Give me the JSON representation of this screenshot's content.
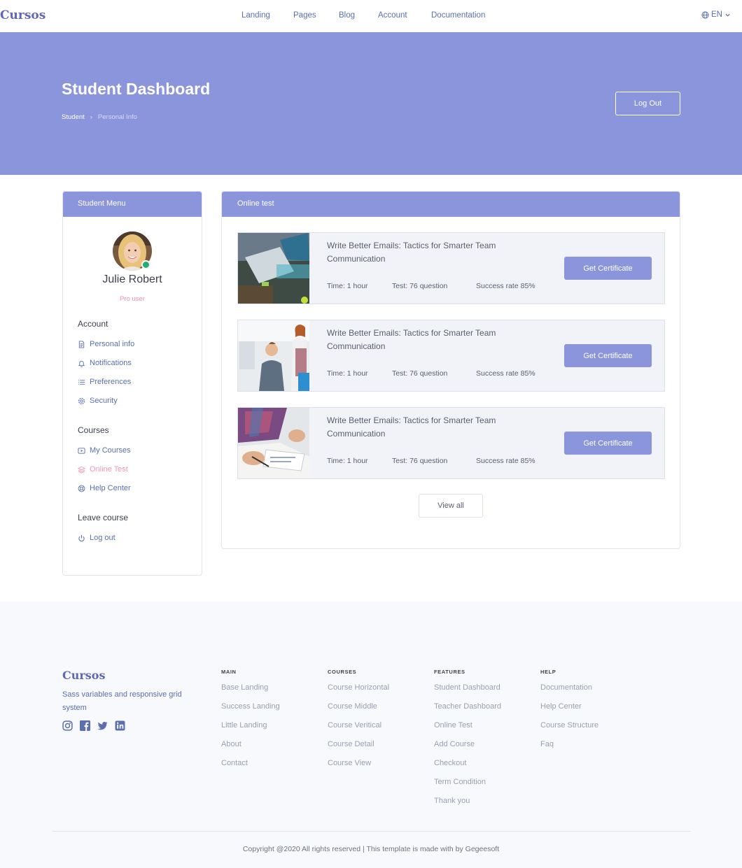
{
  "nav": {
    "brand": "Cursos",
    "links": [
      "Landing",
      "Pages",
      "Blog",
      "Account",
      "Documentation"
    ],
    "language": "EN"
  },
  "hero": {
    "title": "Student Dashboard",
    "breadcrumb": [
      "Student",
      "Personal Info"
    ],
    "logout_label": "Log Out"
  },
  "sidebar": {
    "header": "Student Menu",
    "user_name": "Julie Robert",
    "user_role": "Pro user",
    "sections": [
      {
        "title": "Account",
        "items": [
          {
            "label": "Personal info",
            "icon": "document-icon"
          },
          {
            "label": "Notifications",
            "icon": "bell-icon"
          },
          {
            "label": "Preferences",
            "icon": "list-icon"
          },
          {
            "label": "Security",
            "icon": "gear-icon"
          }
        ]
      },
      {
        "title": "Courses",
        "items": [
          {
            "label": "My Courses",
            "icon": "video-icon"
          },
          {
            "label": "Online Test",
            "icon": "layers-icon",
            "active": true
          },
          {
            "label": "Help Center",
            "icon": "lifebuoy-icon"
          }
        ]
      },
      {
        "title": "Leave course",
        "items": [
          {
            "label": "Log out",
            "icon": "power-icon"
          }
        ]
      }
    ]
  },
  "main": {
    "header": "Online test",
    "courses": [
      {
        "title": "Write Better Emails: Tactics for Smarter Team Communication",
        "time": "Time: 1 hour",
        "test": "Test: 76 question",
        "success": "Success rate 85%",
        "button": "Get Certificate"
      },
      {
        "title": "Write Better Emails: Tactics for Smarter Team Communication",
        "time": "Time: 1 hour",
        "test": "Test: 76 question",
        "success": "Success rate 85%",
        "button": "Get Certificate"
      },
      {
        "title": "Write Better Emails: Tactics for Smarter Team Communication",
        "time": "Time: 1 hour",
        "test": "Test: 76 question",
        "success": "Success rate 85%",
        "button": "Get Certificate"
      }
    ],
    "view_all": "View all"
  },
  "footer": {
    "brand": "Cursos",
    "description": "Sass variables and responsive grid system",
    "social_icons": [
      "instagram-icon",
      "facebook-icon",
      "twitter-icon",
      "linkedin-icon"
    ],
    "columns": [
      {
        "heading": "MAIN",
        "links": [
          "Base Landing",
          "Success Landing",
          "Little Landing",
          "About",
          "Contact"
        ]
      },
      {
        "heading": "COURSES",
        "links": [
          "Course Horizontal",
          "Course Middle",
          "Course Veritical",
          "Course Detail",
          "Course View"
        ]
      },
      {
        "heading": "FEATURES",
        "links": [
          "Student Dashboard",
          "Teacher Dashboard",
          "Online Test",
          "Add Course",
          "Checkout",
          "Term Condition",
          "Thank you"
        ]
      },
      {
        "heading": "HELP",
        "links": [
          "Documentation",
          "Help Center",
          "Course Structure",
          "Faq"
        ]
      }
    ],
    "copyright": "Copyright @2020 All rights reserved | This template is made with by Gegeesoft"
  },
  "colors": {
    "accent": "#8a95dc",
    "brand": "#5f66b8",
    "active_menu": "#f29ab2",
    "online_dot": "#1eb06d"
  }
}
